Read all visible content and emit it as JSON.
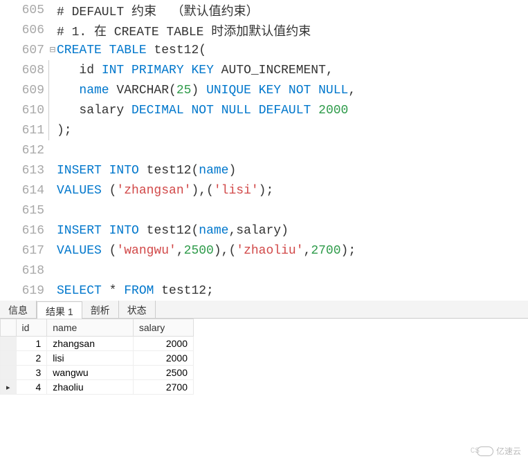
{
  "lines": [
    {
      "num": "605",
      "fold": "",
      "tokens": [
        {
          "t": "# DEFAULT 约束  （默认值约束）",
          "c": "id"
        }
      ]
    },
    {
      "num": "606",
      "fold": "",
      "tokens": [
        {
          "t": "# 1. 在 CREATE TABLE 时添加默认值约束",
          "c": "id"
        }
      ]
    },
    {
      "num": "607",
      "fold": "⊟",
      "tokens": [
        {
          "t": "CREATE",
          "c": "kw"
        },
        {
          "t": " ",
          "c": ""
        },
        {
          "t": "TABLE",
          "c": "kw"
        },
        {
          "t": " test12(",
          "c": "id"
        }
      ]
    },
    {
      "num": "608",
      "fold": "│",
      "indent": "   ",
      "tokens": [
        {
          "t": "id ",
          "c": "id"
        },
        {
          "t": "INT",
          "c": "type"
        },
        {
          "t": " ",
          "c": ""
        },
        {
          "t": "PRIMARY",
          "c": "kw"
        },
        {
          "t": " ",
          "c": ""
        },
        {
          "t": "KEY",
          "c": "kw"
        },
        {
          "t": " AUTO_INCREMENT,",
          "c": "id"
        }
      ]
    },
    {
      "num": "609",
      "fold": "│",
      "indent": "   ",
      "tokens": [
        {
          "t": "name",
          "c": "kw"
        },
        {
          "t": " VARCHAR(",
          "c": "id"
        },
        {
          "t": "25",
          "c": "num"
        },
        {
          "t": ") ",
          "c": "id"
        },
        {
          "t": "UNIQUE",
          "c": "kw"
        },
        {
          "t": " ",
          "c": ""
        },
        {
          "t": "KEY",
          "c": "kw"
        },
        {
          "t": " ",
          "c": ""
        },
        {
          "t": "NOT",
          "c": "kw"
        },
        {
          "t": " ",
          "c": ""
        },
        {
          "t": "NULL",
          "c": "kw"
        },
        {
          "t": ",",
          "c": "id"
        }
      ]
    },
    {
      "num": "610",
      "fold": "│",
      "indent": "   ",
      "tokens": [
        {
          "t": "salary ",
          "c": "id"
        },
        {
          "t": "DECIMAL",
          "c": "type"
        },
        {
          "t": " ",
          "c": ""
        },
        {
          "t": "NOT",
          "c": "kw"
        },
        {
          "t": " ",
          "c": ""
        },
        {
          "t": "NULL",
          "c": "kw"
        },
        {
          "t": " ",
          "c": ""
        },
        {
          "t": "DEFAULT",
          "c": "kw"
        },
        {
          "t": " ",
          "c": ""
        },
        {
          "t": "2000",
          "c": "num"
        }
      ]
    },
    {
      "num": "611",
      "fold": "└",
      "tokens": [
        {
          "t": ");",
          "c": "id"
        }
      ]
    },
    {
      "num": "612",
      "fold": "",
      "tokens": []
    },
    {
      "num": "613",
      "fold": "",
      "tokens": [
        {
          "t": "INSERT",
          "c": "kw"
        },
        {
          "t": " ",
          "c": ""
        },
        {
          "t": "INTO",
          "c": "kw"
        },
        {
          "t": " test12(",
          "c": "id"
        },
        {
          "t": "name",
          "c": "kw"
        },
        {
          "t": ")",
          "c": "id"
        }
      ]
    },
    {
      "num": "614",
      "fold": "",
      "tokens": [
        {
          "t": "VALUES",
          "c": "kw"
        },
        {
          "t": " (",
          "c": "id"
        },
        {
          "t": "'zhangsan'",
          "c": "str"
        },
        {
          "t": "),(",
          "c": "id"
        },
        {
          "t": "'lisi'",
          "c": "str"
        },
        {
          "t": ");",
          "c": "id"
        }
      ]
    },
    {
      "num": "615",
      "fold": "",
      "tokens": []
    },
    {
      "num": "616",
      "fold": "",
      "tokens": [
        {
          "t": "INSERT",
          "c": "kw"
        },
        {
          "t": " ",
          "c": ""
        },
        {
          "t": "INTO",
          "c": "kw"
        },
        {
          "t": " test12(",
          "c": "id"
        },
        {
          "t": "name",
          "c": "kw"
        },
        {
          "t": ",salary)",
          "c": "id"
        }
      ]
    },
    {
      "num": "617",
      "fold": "",
      "tokens": [
        {
          "t": "VALUES",
          "c": "kw"
        },
        {
          "t": " (",
          "c": "id"
        },
        {
          "t": "'wangwu'",
          "c": "str"
        },
        {
          "t": ",",
          "c": "id"
        },
        {
          "t": "2500",
          "c": "num"
        },
        {
          "t": "),(",
          "c": "id"
        },
        {
          "t": "'zhaoliu'",
          "c": "str"
        },
        {
          "t": ",",
          "c": "id"
        },
        {
          "t": "2700",
          "c": "num"
        },
        {
          "t": ");",
          "c": "id"
        }
      ]
    },
    {
      "num": "618",
      "fold": "",
      "tokens": []
    },
    {
      "num": "619",
      "fold": "",
      "tokens": [
        {
          "t": "SELECT",
          "c": "kw"
        },
        {
          "t": " * ",
          "c": "id"
        },
        {
          "t": "FROM",
          "c": "kw"
        },
        {
          "t": " test12;",
          "c": "id"
        }
      ]
    }
  ],
  "tabs": [
    {
      "label": "信息",
      "active": false
    },
    {
      "label": "结果 1",
      "active": true
    },
    {
      "label": "剖析",
      "active": false
    },
    {
      "label": "状态",
      "active": false
    }
  ],
  "result": {
    "columns": [
      "id",
      "name",
      "salary"
    ],
    "rows": [
      {
        "pointer": "",
        "id": "1",
        "name": "zhangsan",
        "salary": "2000"
      },
      {
        "pointer": "",
        "id": "2",
        "name": "lisi",
        "salary": "2000"
      },
      {
        "pointer": "",
        "id": "3",
        "name": "wangwu",
        "salary": "2500"
      },
      {
        "pointer": "▸",
        "id": "4",
        "name": "zhaoliu",
        "salary": "2700"
      }
    ]
  },
  "watermark": "亿速云",
  "cs_mark": "CS"
}
